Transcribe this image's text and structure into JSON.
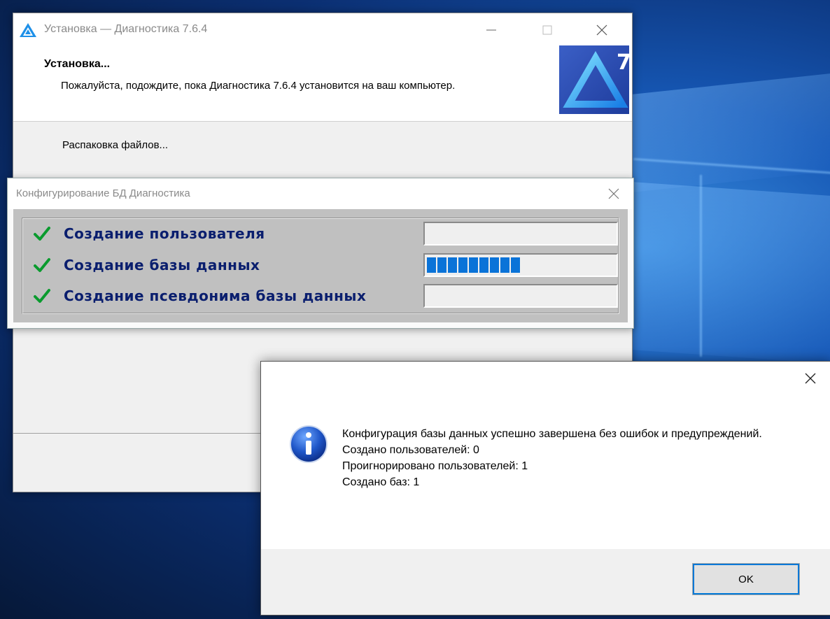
{
  "installer": {
    "title": "Установка — Диагностика 7.6.4",
    "header_title": "Установка...",
    "header_subtitle": "Пожалуйста, подождите, пока Диагностика 7.6.4 установится на ваш компьютер.",
    "status": "Распаковка файлов...",
    "logo_icon": "diagnostika-7-logo-icon"
  },
  "config": {
    "title": "Конфигурирование БД Диагностика",
    "steps": [
      {
        "label": "Создание пользователя",
        "done": true,
        "progress_segments": 0
      },
      {
        "label": "Создание базы данных",
        "done": true,
        "progress_segments": 9
      },
      {
        "label": "Создание псевдонима базы данных",
        "done": true,
        "progress_segments": 0
      }
    ],
    "check_color": "#0a9b2e",
    "progress_color": "#0a73d8"
  },
  "msgbox": {
    "lines": [
      "Конфигурация базы данных успешно завершена без ошибок и предупреждений.",
      "Создано пользователей: 0",
      "Проигнорировано пользователей: 1",
      "Создано баз: 1"
    ],
    "ok_label": "OK",
    "icon": "info-icon"
  }
}
